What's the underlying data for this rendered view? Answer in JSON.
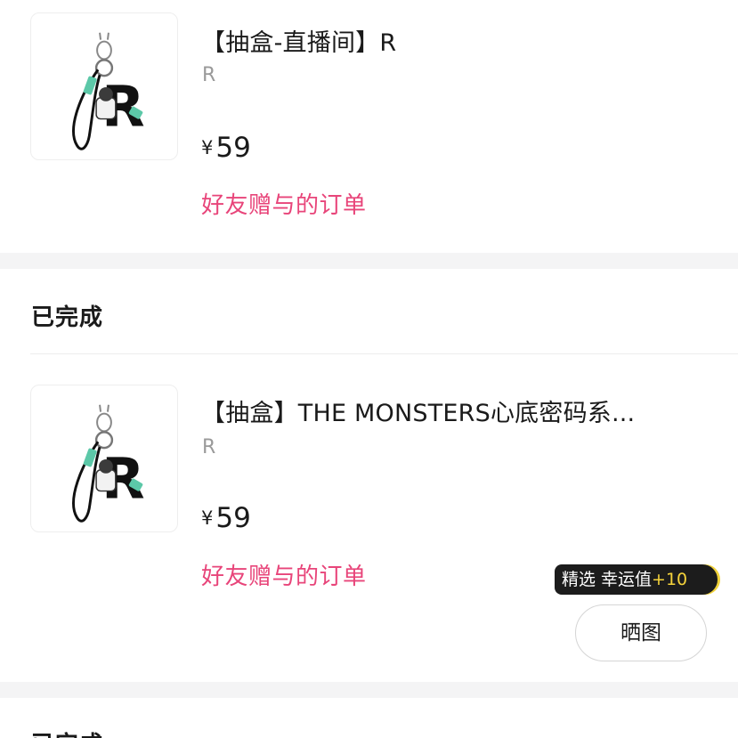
{
  "orders": [
    {
      "title": "【抽盒-直播间】R",
      "variant": "R",
      "currency": "¥",
      "price": "59",
      "gift_note": "好友赠与的订单"
    },
    {
      "status": "已完成",
      "title": "【抽盒】THE MONSTERS心底密码系...",
      "variant": "R",
      "currency": "¥",
      "price": "59",
      "gift_note": "好友赠与的订单",
      "promo": {
        "label": "精选 幸运值",
        "bonus": "+10"
      },
      "share_button": "晒图"
    },
    {
      "status": "已完成"
    }
  ],
  "colors": {
    "gift_note": "#e8457a",
    "promo_bg": "#1c1c1c",
    "promo_accent": "#f5d33b",
    "section_gap": "#f4f4f5"
  },
  "icons": [
    "keychain-product-image"
  ]
}
